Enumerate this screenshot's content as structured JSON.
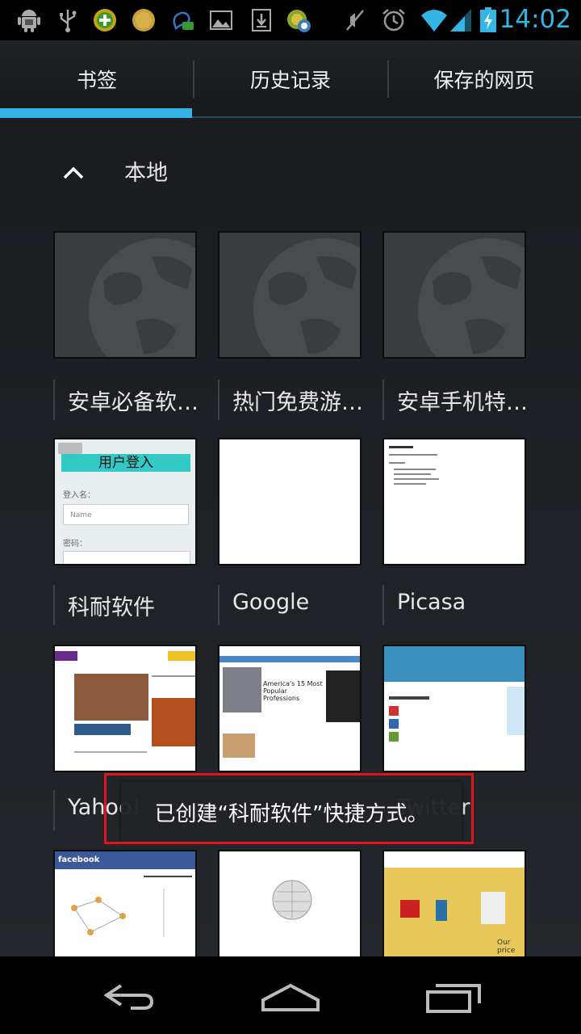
{
  "status_bar": {
    "time": "14:02",
    "icons": [
      "android-debug-icon",
      "usb-icon",
      "plus-app-icon",
      "coin-app-icon",
      "chat-app-icon",
      "image-icon",
      "download-icon",
      "sync-app-icon",
      "mute-icon",
      "alarm-icon",
      "wifi-icon",
      "signal-icon",
      "battery-charging-icon"
    ]
  },
  "tabs": [
    {
      "label": "书签",
      "selected": true
    },
    {
      "label": "历史记录",
      "selected": false
    },
    {
      "label": "保存的网页",
      "selected": false
    }
  ],
  "section": {
    "label": "本地",
    "icon": "chevron-up-icon"
  },
  "bookmarks": [
    {
      "title": "安卓必备软…",
      "thumbnail": "globe-placeholder"
    },
    {
      "title": "热门免费游…",
      "thumbnail": "globe-placeholder"
    },
    {
      "title": "安卓手机特…",
      "thumbnail": "globe-placeholder"
    },
    {
      "title": "科耐软件",
      "thumbnail": "login-page",
      "login_title": "用户登入",
      "login_user_label": "登入名：",
      "login_user_placeholder": "Name",
      "login_pass_label": "密码："
    },
    {
      "title": "Google",
      "thumbnail": "blank"
    },
    {
      "title": "Picasa",
      "thumbnail": "text-page"
    },
    {
      "title": "Yahoo!",
      "thumbnail": "news-page",
      "thumb_text": "America's 15 Most Popular Professions"
    },
    {
      "title": "",
      "thumbnail": "news-page-2"
    },
    {
      "title": "Twitter",
      "thumbnail": "twitter-page"
    },
    {
      "title": "",
      "thumbnail": "facebook-page",
      "thumb_text": "facebook"
    },
    {
      "title": "",
      "thumbnail": "wikipedia-page"
    },
    {
      "title": "",
      "thumbnail": "shopping-page",
      "thumb_text": "Our price"
    }
  ],
  "toast": {
    "text": "已创建“科耐软件”快捷方式。"
  },
  "nav_bar": {
    "buttons": [
      "back-icon",
      "home-icon",
      "recent-apps-icon"
    ]
  },
  "colors": {
    "accent": "#33b5e5",
    "highlight_box": "#e0141a"
  }
}
